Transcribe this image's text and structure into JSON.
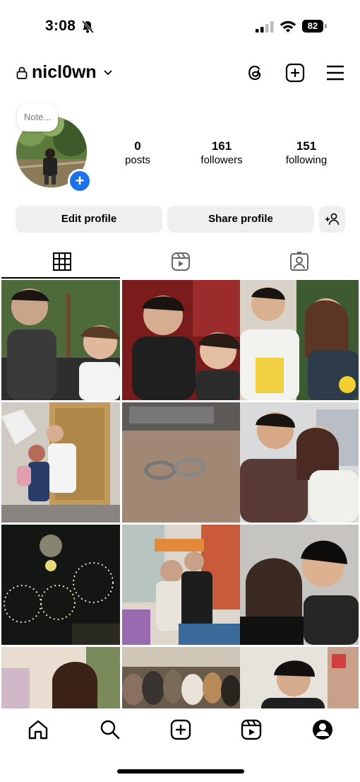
{
  "status_bar": {
    "time": "3:08",
    "battery": "82",
    "icons": [
      "bell-slash-icon",
      "signal-icon",
      "wifi-icon",
      "battery-icon"
    ]
  },
  "header": {
    "username": "nicl0wn",
    "icons": [
      "lock-icon",
      "chevron-down-icon",
      "threads-icon",
      "new-post-icon",
      "menu-icon"
    ]
  },
  "profile": {
    "note_placeholder": "Note...",
    "stats": [
      {
        "value": "0",
        "label": "posts"
      },
      {
        "value": "161",
        "label": "followers"
      },
      {
        "value": "151",
        "label": "following"
      }
    ]
  },
  "actions": {
    "edit": "Edit profile",
    "share": "Share profile"
  },
  "tabs": [
    "grid-icon",
    "reels-icon",
    "tagged-icon"
  ],
  "colors": {
    "accent": "#1a73e8",
    "button_bg": "#efefef"
  },
  "bottom_nav": [
    "home-icon",
    "search-icon",
    "create-icon",
    "reels-icon",
    "profile-icon"
  ]
}
